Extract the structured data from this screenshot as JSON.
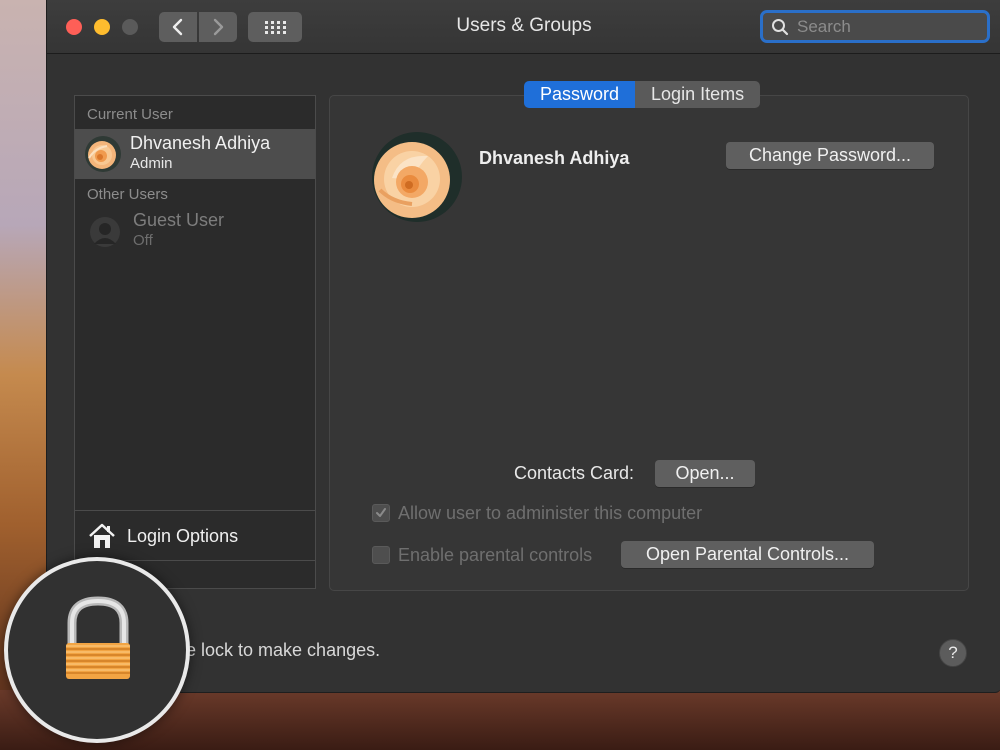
{
  "window": {
    "title": "Users & Groups"
  },
  "search": {
    "placeholder": "Search"
  },
  "sidebar": {
    "current_user_header": "Current User",
    "current_user": {
      "name": "Dhvanesh Adhiya",
      "role": "Admin"
    },
    "other_users_header": "Other Users",
    "guest_user": {
      "name": "Guest User",
      "status": "Off"
    },
    "login_options_label": "Login Options"
  },
  "tabs": [
    {
      "label": "Password",
      "active": true
    },
    {
      "label": "Login Items",
      "active": false
    }
  ],
  "profile": {
    "name": "Dhvanesh Adhiya"
  },
  "buttons": {
    "change_password": "Change Password...",
    "open": "Open...",
    "open_parental_controls": "Open Parental Controls..."
  },
  "contacts_card_label": "Contacts Card:",
  "checkboxes": {
    "allow_admin": {
      "label": "Allow user to administer this computer",
      "checked": true,
      "enabled": false
    },
    "parental": {
      "label": "Enable parental controls",
      "checked": false,
      "enabled": false
    }
  },
  "lock_text": "C  e lock to make changes.",
  "help_label": "?",
  "icons": [
    "search-icon",
    "chevron-left-icon",
    "chevron-right-icon",
    "grid-icon",
    "house-icon",
    "padlock-icon",
    "user-avatar-icon",
    "guest-silhouette-icon",
    "checkmark-icon"
  ],
  "colors": {
    "accent": "#1f6fd9",
    "window_bg": "#323232",
    "close": "#fe5f57",
    "minimize": "#febc2e",
    "padlock": "#f2a443"
  }
}
